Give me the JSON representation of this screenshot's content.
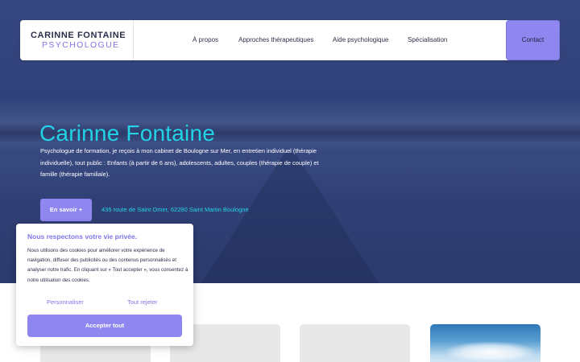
{
  "header": {
    "logo": {
      "name": "CARINNE FONTAINE",
      "subtitle": "PSYCHOLOGUE"
    },
    "nav": [
      {
        "label": "À propos"
      },
      {
        "label": "Approches thérapeutiques"
      },
      {
        "label": "Aide psychologique"
      },
      {
        "label": "Spécialisation"
      }
    ],
    "contact_label": "Contact"
  },
  "hero": {
    "title": "Carinne Fontaine",
    "description": "Psychologue de formation, je reçois à mon cabinet de Boulogne sur Mer, en entretien individuel (thérapie individuelle), tout public : Enfants (à partir de 6 ans), adolescents, adultes, couples (thérapie de couple) et famille (thérapie familiale).",
    "cta_label": "En savoir +",
    "address": "435 route de Saint Omer, 62280 Saint Martin Boulogne"
  },
  "cookie_banner": {
    "title": "Nous respectons votre vie privée.",
    "text": "Nous utilisons des cookies pour améliorer votre expérience de navigation, diffuser des publicités ou des contenus personnalisés et analyser notre trafic. En cliquant sur « Tout accepter », vous consentez à notre utilisation des cookies.",
    "customize_label": "Personnaliser",
    "reject_label": "Tout rejeter",
    "accept_label": "Accepter tout"
  },
  "colors": {
    "accent": "#8f86ef",
    "cyan": "#22d3e6",
    "hero_overlay": "#33437c",
    "text_dark": "#2c2f4a"
  }
}
